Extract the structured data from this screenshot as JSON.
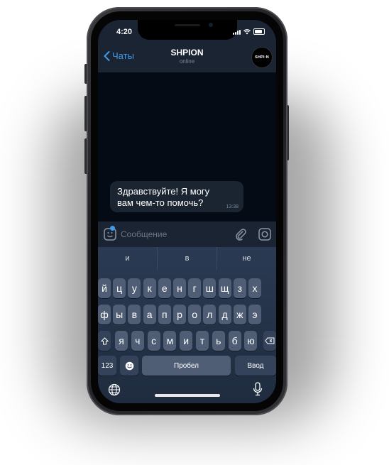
{
  "status": {
    "time": "4:20"
  },
  "nav": {
    "back_label": "Чаты",
    "title": "SHPION",
    "subtitle": "online",
    "avatar_text": "SHPI·N"
  },
  "chat": {
    "message_text": "Здравствуйте! Я могу\nвам чем-то помочь?",
    "message_time": "13:38"
  },
  "input": {
    "placeholder": "Сообщение",
    "value": ""
  },
  "keyboard": {
    "suggestions": [
      "и",
      "в",
      "не"
    ],
    "row1": [
      "й",
      "ц",
      "у",
      "к",
      "е",
      "н",
      "г",
      "ш",
      "щ",
      "з",
      "х"
    ],
    "row2": [
      "ф",
      "ы",
      "в",
      "а",
      "п",
      "р",
      "о",
      "л",
      "д",
      "ж",
      "э"
    ],
    "row3": [
      "я",
      "ч",
      "с",
      "м",
      "и",
      "т",
      "ь",
      "б",
      "ю"
    ],
    "numbers_label": "123",
    "space_label": "Пробел",
    "return_label": "Ввод"
  },
  "colors": {
    "accent": "#3d9be9",
    "chat_bg": "#050b14",
    "bar_bg": "#1a2433",
    "key_bg": "#4f5e74"
  },
  "icons": [
    "chevron-left-icon",
    "signal-icon",
    "wifi-icon",
    "battery-icon",
    "sticker-icon",
    "paperclip-icon",
    "camera-icon",
    "shift-icon",
    "backspace-icon",
    "emoji-icon",
    "globe-icon",
    "microphone-icon"
  ]
}
